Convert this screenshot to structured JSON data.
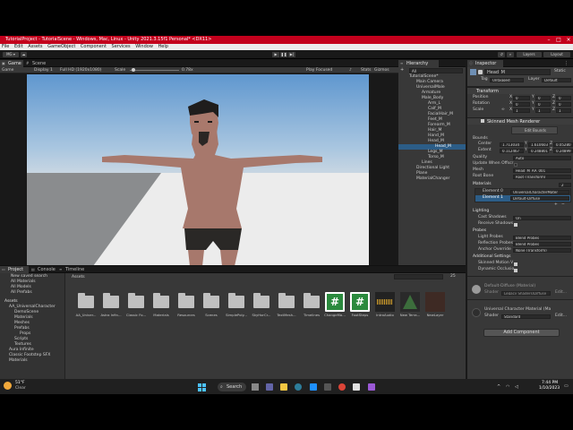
{
  "window": {
    "title": "TutorialProject - TutorialScene - Windows, Mac, Linux - Unity 2021.3.15f1 Personal* <DX11>"
  },
  "menu": [
    "File",
    "Edit",
    "Assets",
    "GameObject",
    "Component",
    "Services",
    "Window",
    "Help"
  ],
  "toolbar": {
    "account": "MG ▾",
    "layers": "Layers",
    "layout": "Layout"
  },
  "tabs": {
    "game": "Game",
    "scene": "Scene",
    "hierarchy": "Hierarchy",
    "inspector": "Inspector",
    "project": "Project",
    "console": "Console",
    "timeline": "Timeline"
  },
  "game": {
    "mode": "Game",
    "display": "Display 1",
    "resolution": "Full HD (1920x1080)",
    "scale_label": "Scale",
    "scale_value": "0.78x",
    "play_focused": "Play Focused",
    "stats": "Stats",
    "gizmos": "Gizmos"
  },
  "hierarchy": {
    "search": "All",
    "items": [
      "TutorialScene*",
      "Main Camera",
      "UniversalMale",
      "Armature",
      "Male_Body",
      "Arm_L",
      "Calf_M",
      "FacialHair_M",
      "Feet_M",
      "Forearm_M",
      "Hair_M",
      "Hand_M",
      "Head_M",
      "Head_M",
      "Legs_M",
      "Torso_M",
      "Lines",
      "Directional Light",
      "Plane",
      "MaterialChanger"
    ]
  },
  "inspector": {
    "object_name": "Head_M",
    "static_label": "Static",
    "tag_label": "Tag",
    "tag_value": "Untagged",
    "layer_label": "Layer",
    "layer_value": "Default",
    "transform": {
      "title": "Transform",
      "position": {
        "label": "Position",
        "x": "0",
        "y": "0",
        "z": "0"
      },
      "rotation": {
        "label": "Rotation",
        "x": "0",
        "y": "0",
        "z": "0"
      },
      "scale": {
        "label": "Scale",
        "x": "1",
        "y": "1",
        "z": "1"
      }
    },
    "smr": {
      "title": "Skinned Mesh Renderer",
      "edit_bounds": "Edit Bounds",
      "bounds": "Bounds",
      "center_label": "Center",
      "center": {
        "x": "1.713034",
        "y": "1.610603",
        "z": "0.05280"
      },
      "extent_label": "Extent",
      "extent": {
        "x": "0.112467",
        "y": "0.248801",
        "z": "0.24899"
      },
      "quality_label": "Quality",
      "quality": "Auto",
      "update_label": "Update When Offscr",
      "mesh_label": "Mesh",
      "mesh": "Head_M_AA_001",
      "root_bone_label": "Root Bone",
      "root_bone": "Root (Transform)"
    },
    "materials": {
      "title": "Materials",
      "count": "2",
      "element0_label": "Element 0",
      "element0": "UniversalCharacterMater",
      "element1_label": "Element 1",
      "element1": "Default-Diffuse"
    },
    "lighting": {
      "title": "Lighting",
      "cast_label": "Cast Shadows",
      "cast": "On",
      "receive_label": "Receive Shadows"
    },
    "probes": {
      "title": "Probes",
      "light_label": "Light Probes",
      "light": "Blend Probes",
      "refl_label": "Reflection Probes",
      "refl": "Blend Probes",
      "anchor_label": "Anchor Override",
      "anchor": "None (Transform)"
    },
    "additional": {
      "title": "Additional Settings",
      "skinned_motion": "Skinned Motion V",
      "dynamic_occlusion": "Dynamic Occlusio"
    },
    "mat1": {
      "name": "Default-Diffuse (Material)",
      "shader_label": "Shader",
      "shader": "Legacy Shaders/Diffuse",
      "edit": "Edit..."
    },
    "mat2": {
      "name": "Universal Character Material (Ma",
      "shader_label": "Shader",
      "shader": "Standard",
      "edit": "Edit..."
    },
    "add_component": "Add Component"
  },
  "project": {
    "favorites": [
      "New saved search",
      "All Materials",
      "All Models",
      "All Prefabs"
    ],
    "assets_root": "Assets",
    "tree": [
      "AA_UniversalCharacter",
      "DemoScene",
      "Materials",
      "Meshes",
      "Prefabs",
      "Props",
      "Scripts",
      "Textures",
      "Aura Infinite",
      "Classic Footstep SFX",
      "Materials"
    ],
    "breadcrumb": "Assets",
    "items": [
      "AA_Univer...",
      "Astra Infin...",
      "Classic Fo...",
      "Materials",
      "Resources",
      "Scenes",
      "SimplePoly...",
      "SkyHorCr...",
      "TextMesh...",
      "Timelines",
      "ChangeMa...",
      "FootSteps",
      "IntroAudio",
      "New Terra...",
      "NewLayer"
    ],
    "count": "25"
  },
  "taskbar": {
    "weather_temp": "51°F",
    "weather_desc": "Clear",
    "search": "Search",
    "time": "7:44 PM",
    "date": "1/10/2023"
  },
  "colors": {
    "titlebar": "#c3001c",
    "panel": "#383838",
    "dark": "#191919",
    "selection": "#2c5d87",
    "sky_top": "#6fa6d8",
    "ground": "#e8e8e8"
  }
}
